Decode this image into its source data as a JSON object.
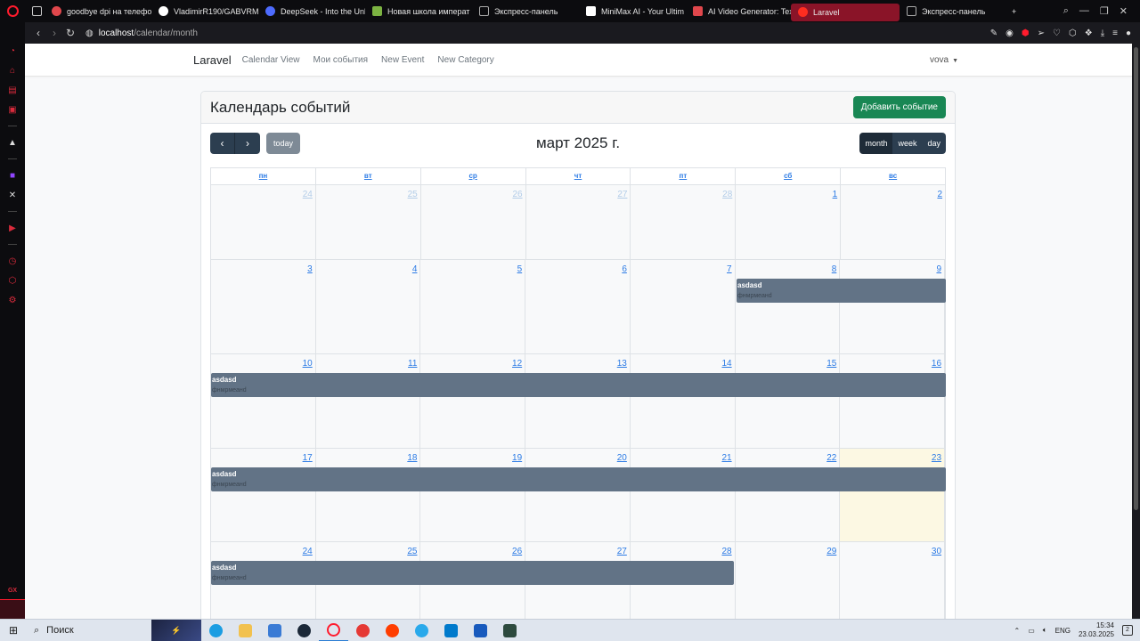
{
  "browser": {
    "tabs": [
      {
        "title": "goodbye dpi на телефо",
        "icon_color": "#e0474c"
      },
      {
        "title": "VladimirR190/GABVRM",
        "icon_color": "#ffffff"
      },
      {
        "title": "DeepSeek - Into the Unk",
        "icon_color": "#4d6bfe"
      },
      {
        "title": "Новая школа императ",
        "icon_color": "#7cb342"
      },
      {
        "title": "Экспресс-панель",
        "icon_color": "#888888"
      },
      {
        "title": "MiniMax AI - Your Ultim",
        "icon_color": "#ffffff"
      },
      {
        "title": "AI Video Generator: Tex",
        "icon_color": "#e0474c"
      },
      {
        "title": "Laravel",
        "icon_color": "#ff2d20"
      },
      {
        "title": "Экспресс-панель",
        "icon_color": "#888888"
      }
    ],
    "active_tab": 7,
    "new_tab_label": "+",
    "url_host": "localhost",
    "url_path": "/calendar/month"
  },
  "navbar": {
    "brand": "Laravel",
    "links": [
      "Calendar View",
      "Мои события",
      "New Event",
      "New Category"
    ],
    "user": "vova"
  },
  "calendar": {
    "header_title": "Календарь событий",
    "add_button": "Добавить событие",
    "today_button": "today",
    "prev_icon": "‹",
    "next_icon": "›",
    "title": "март 2025 г.",
    "views": [
      "month",
      "week",
      "day"
    ],
    "active_view": "month",
    "weekdays": [
      "пн",
      "вт",
      "ср",
      "чт",
      "пт",
      "сб",
      "вс"
    ],
    "weeks": [
      {
        "days": [
          "24",
          "25",
          "26",
          "27",
          "28",
          "1",
          "2"
        ]
      },
      {
        "days": [
          "3",
          "4",
          "5",
          "6",
          "7",
          "8",
          "9"
        ]
      },
      {
        "days": [
          "10",
          "11",
          "12",
          "13",
          "14",
          "15",
          "16"
        ]
      },
      {
        "days": [
          "17",
          "18",
          "19",
          "20",
          "21",
          "22",
          "23"
        ]
      },
      {
        "days": [
          "24",
          "25",
          "26",
          "27",
          "28",
          "29",
          "30"
        ]
      }
    ],
    "today": "23",
    "events": [
      {
        "title": "asdasd",
        "description": "фнмрмeaнd"
      },
      {
        "title": "asdasd",
        "description": "фнмрмeaнd"
      },
      {
        "title": "asdasd",
        "description": "фнмрмeaнd"
      },
      {
        "title": "asdasd",
        "description": "фнмрмeaнd"
      }
    ],
    "event_color": "#627386"
  },
  "taskbar": {
    "search_label": "Поиск",
    "language": "ENG",
    "time": "15:34",
    "date": "23.03.2025",
    "notifications": "2"
  }
}
